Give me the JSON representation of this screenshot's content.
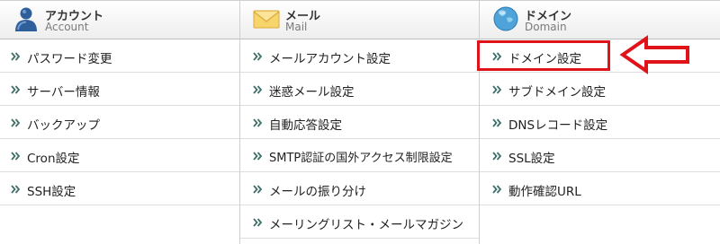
{
  "columns": {
    "account": {
      "title": "アカウント",
      "subtitle": "Account",
      "icon": "user-icon",
      "items": [
        "パスワード変更",
        "サーバー情報",
        "バックアップ",
        "Cron設定",
        "SSH設定"
      ]
    },
    "mail": {
      "title": "メール",
      "subtitle": "Mail",
      "icon": "envelope-icon",
      "items": [
        "メールアカウント設定",
        "迷惑メール設定",
        "自動応答設定",
        "SMTP認証の国外アクセス制限設定",
        "メールの振り分け",
        "メーリングリスト・メールマガジン"
      ]
    },
    "domain": {
      "title": "ドメイン",
      "subtitle": "Domain",
      "icon": "globe-icon",
      "items": [
        "ドメイン設定",
        "サブドメイン設定",
        "DNSレコード設定",
        "SSL設定",
        "動作確認URL"
      ]
    }
  },
  "annotation": {
    "highlight_color": "#e0121a",
    "highlighted_item": "ドメイン設定"
  }
}
